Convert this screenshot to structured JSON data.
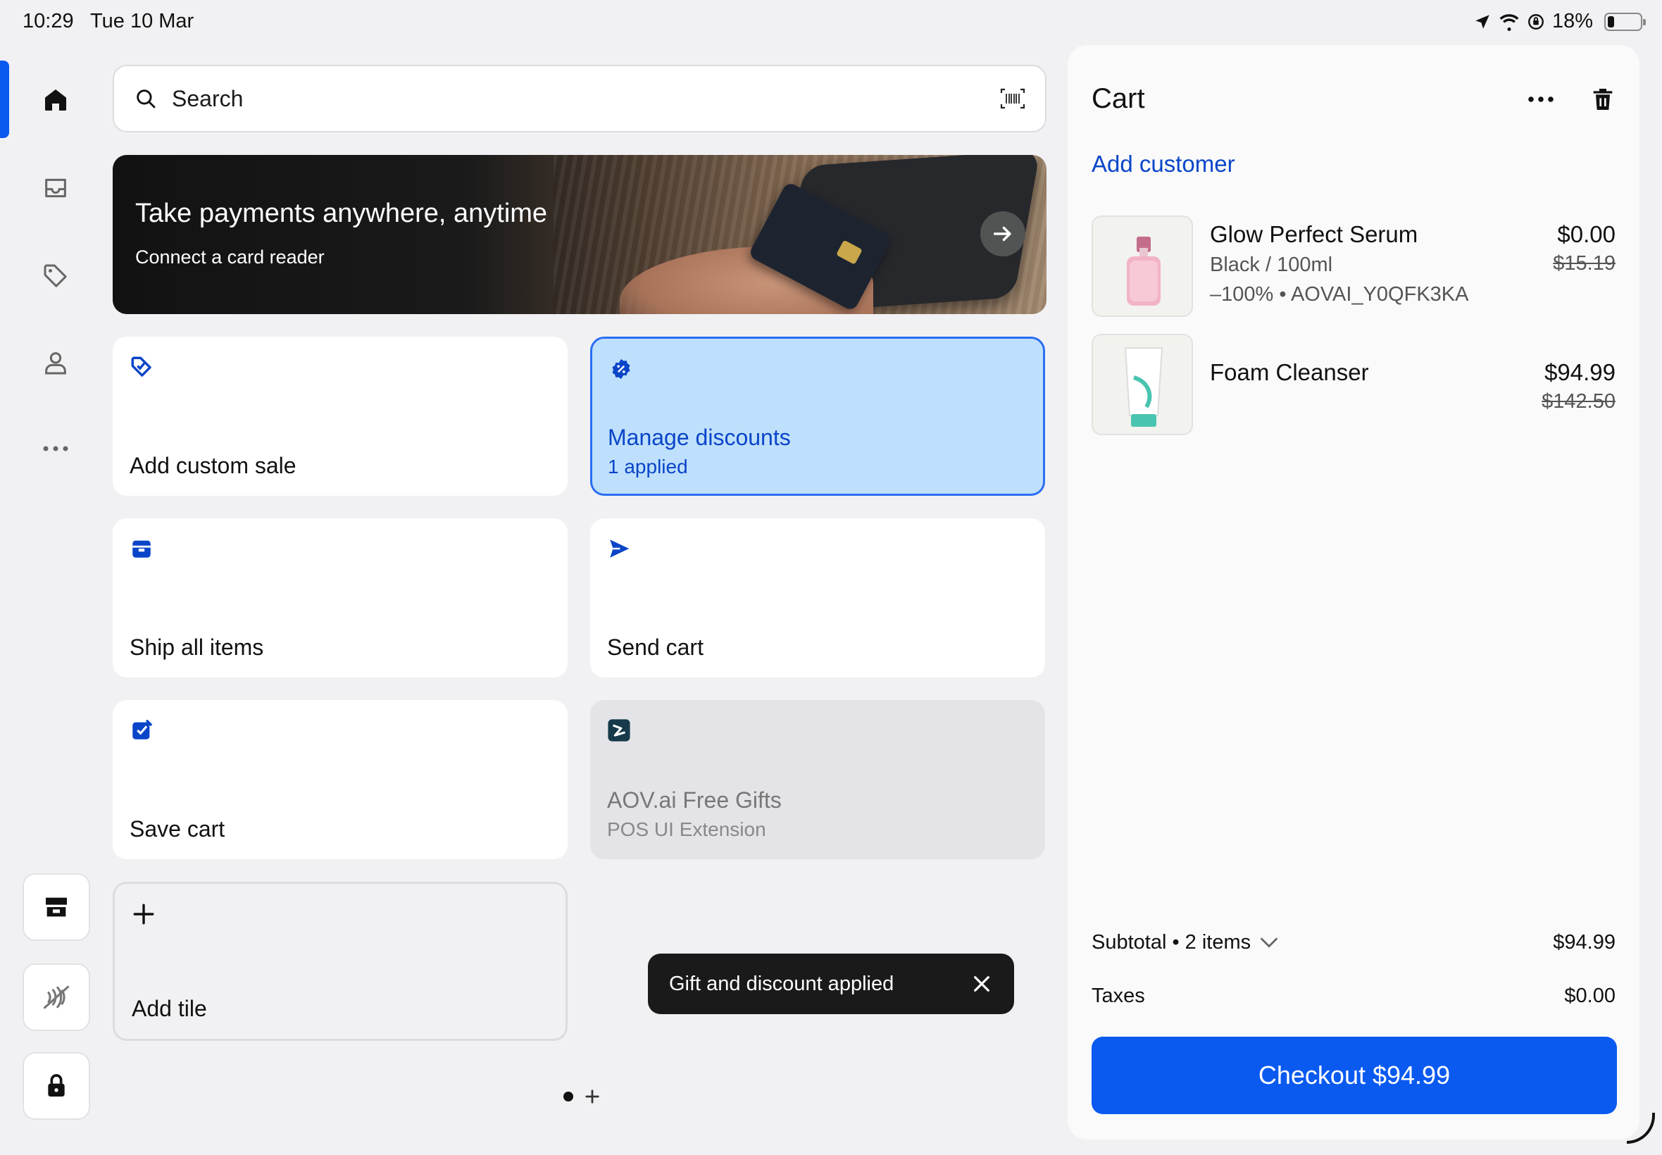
{
  "status_bar": {
    "time": "10:29",
    "date": "Tue 10 Mar",
    "battery": "18%"
  },
  "search": {
    "placeholder": "Search"
  },
  "banner": {
    "title": "Take payments anywhere, anytime",
    "subtitle": "Connect a card reader"
  },
  "tiles": {
    "add_custom_sale": "Add custom sale",
    "manage_discounts": "Manage discounts",
    "manage_discounts_sub": "1 applied",
    "ship_all_items": "Ship all items",
    "send_cart": "Send cart",
    "save_cart": "Save cart",
    "extension_title": "AOV.ai Free Gifts",
    "extension_sub": "POS UI Extension",
    "add_tile": "Add tile"
  },
  "toast": {
    "message": "Gift and discount applied"
  },
  "cart": {
    "title": "Cart",
    "add_customer": "Add customer",
    "items": [
      {
        "name": "Glow Perfect Serum",
        "variant": "Black / 100ml",
        "discount": "–100% • AOVAI_Y0QFK3KA",
        "price": "$0.00",
        "original_price": "$15.19"
      },
      {
        "name": "Foam Cleanser",
        "price": "$94.99",
        "original_price": "$142.50"
      }
    ],
    "subtotal_label": "Subtotal • 2 items",
    "subtotal_value": "$94.99",
    "taxes_label": "Taxes",
    "taxes_value": "$0.00",
    "checkout_label": "Checkout $94.99"
  },
  "colors": {
    "accent": "#0a5af0",
    "link": "#0a45c8",
    "discount_tile_bg": "#bfe0fc"
  }
}
